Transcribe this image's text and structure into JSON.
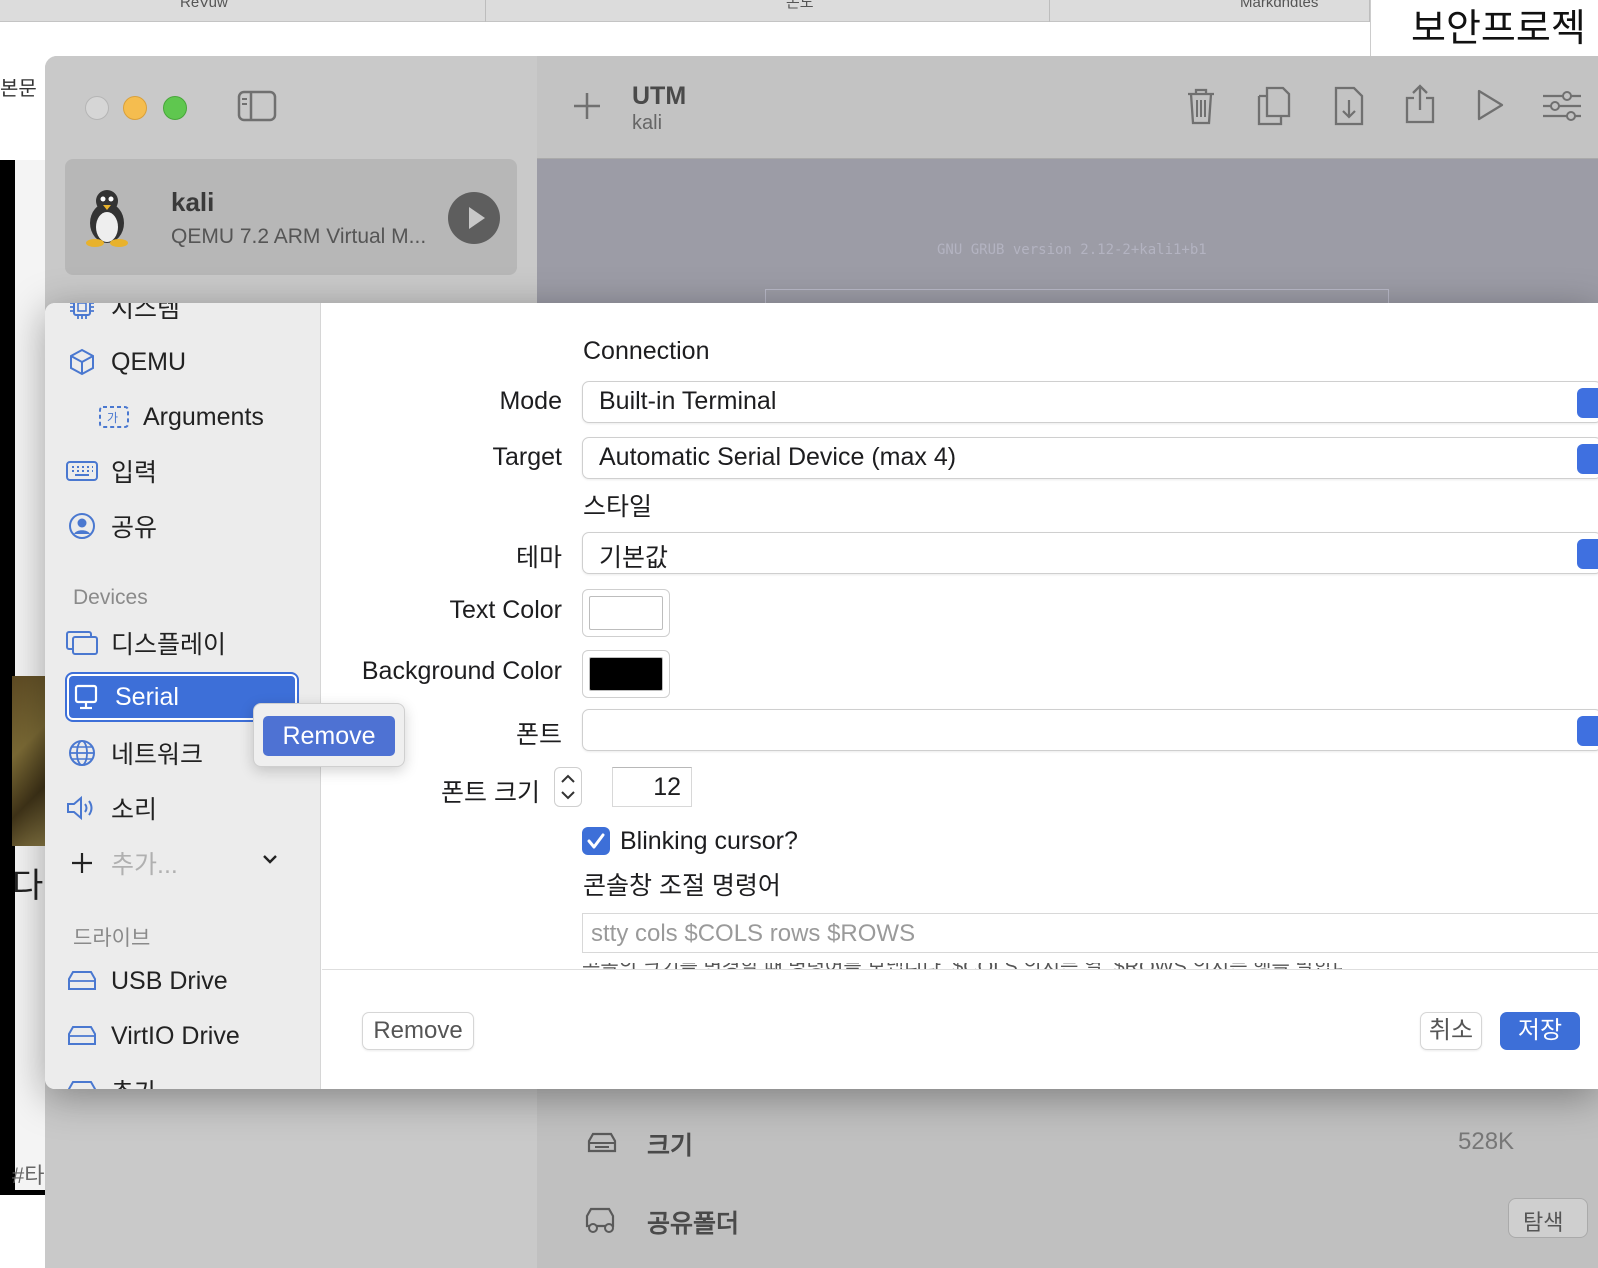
{
  "background": {
    "browser_tabs": [
      "ReVuw",
      "몬노",
      "Markdndtes"
    ],
    "right_heading": "보안프로젝",
    "left_snippet": "본문",
    "snippet_da": "다",
    "snippet_hash": "#타"
  },
  "utm": {
    "toolbar": {
      "title": "UTM",
      "subtitle": "kali"
    },
    "vm_card": {
      "name": "kali",
      "description": "QEMU 7.2 ARM Virtual M..."
    },
    "preview_text": "GNU GRUB  version 2.12-2+kali1+b1",
    "info_rows": [
      {
        "label": "크기",
        "value": "528K"
      },
      {
        "label": "공유폴더",
        "action": "탐색"
      }
    ]
  },
  "settings": {
    "sidebar": {
      "items_top": [
        {
          "label": "시스템",
          "icon": "cpu-icon"
        },
        {
          "label": "QEMU",
          "icon": "cube-icon"
        },
        {
          "label": "Arguments",
          "icon": "text-field-icon"
        },
        {
          "label": "입력",
          "icon": "keyboard-icon"
        },
        {
          "label": "공유",
          "icon": "person-circle-icon"
        }
      ],
      "devices_header": "Devices",
      "devices": [
        {
          "label": "디스플레이",
          "icon": "display-icon"
        },
        {
          "label": "Serial",
          "icon": "serial-monitor-icon"
        },
        {
          "label": "네트워크",
          "icon": "globe-icon"
        },
        {
          "label": "소리",
          "icon": "speaker-icon"
        }
      ],
      "add_label": "추가...",
      "drives_header": "드라이브",
      "drives": [
        {
          "label": "USB Drive",
          "icon": "drive-icon"
        },
        {
          "label": "VirtIO Drive",
          "icon": "drive-icon"
        },
        {
          "label": "추가",
          "icon": "drive-icon"
        }
      ],
      "context_menu_remove": "Remove"
    },
    "form": {
      "connection_header": "Connection",
      "mode_label": "Mode",
      "mode_value": "Built-in Terminal",
      "target_label": "Target",
      "target_value": "Automatic Serial Device (max 4)",
      "style_header": "스타일",
      "theme_label": "테마",
      "theme_value": "기본값",
      "text_color_label": "Text Color",
      "text_color": "#ffffff",
      "background_color_label": "Background Color",
      "background_color": "#000000",
      "font_label": "폰트",
      "font_value": "",
      "font_size_label": "폰트 크기",
      "font_size_value": "12",
      "blinking_cursor_label": "Blinking cursor?",
      "blinking_cursor_checked": true,
      "resize_command_header": "콘솔창 조절 명령어",
      "resize_command_placeholder": "stty cols $COLS rows $ROWS",
      "resize_command_help": "콘솔의 크기를 변경할 때 명령어를 보냅니다. $COLS 의지는 열, $ROWS 의지는 행을 말합니다."
    },
    "footer": {
      "remove_label": "Remove",
      "cancel_label": "취소",
      "save_label": "저장"
    }
  },
  "colors": {
    "accent": "#3d6fd8",
    "selected_row": "#3d6fd8",
    "sidebar_bg": "#ececec"
  }
}
